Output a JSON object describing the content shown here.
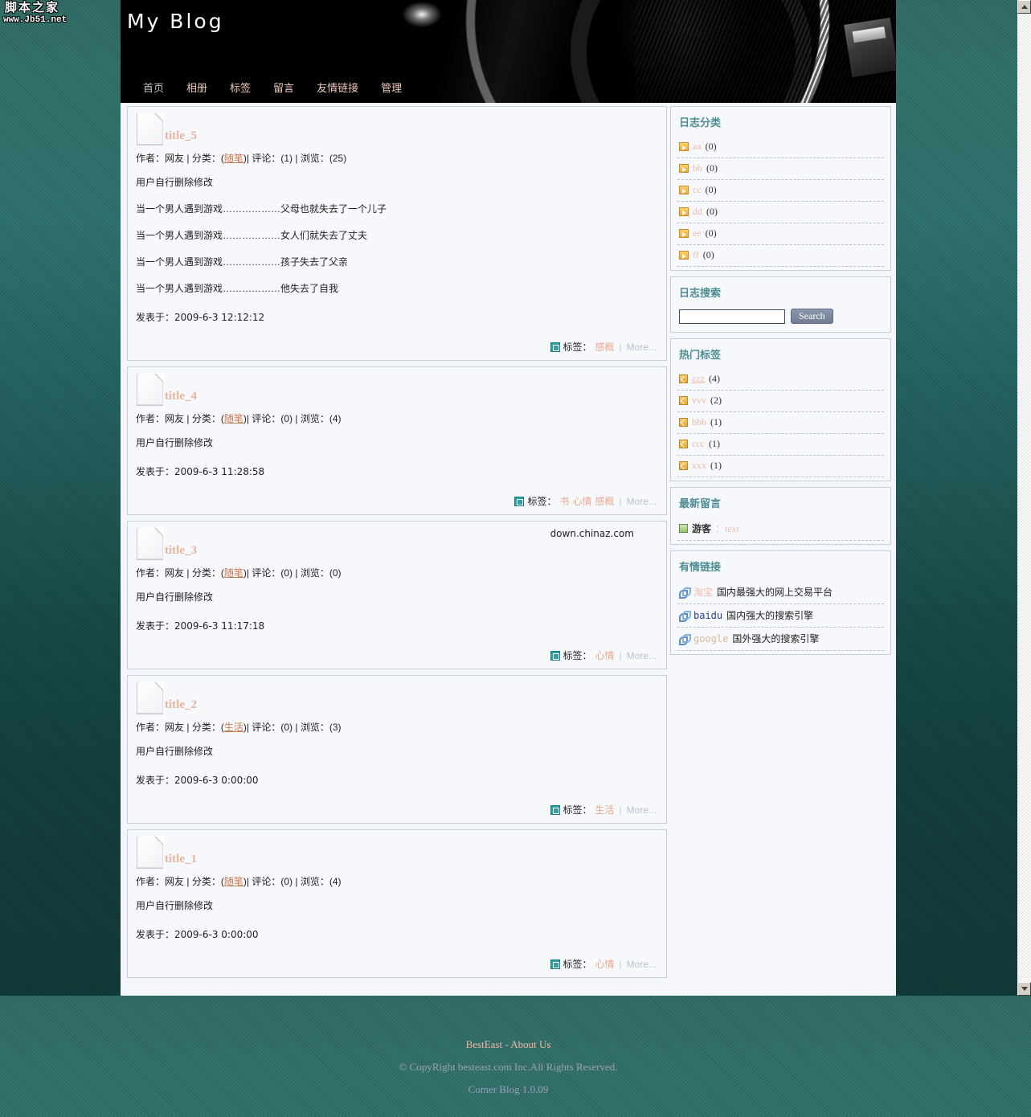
{
  "watermark": {
    "line1": "脚本之家",
    "line2": "www.Jb51.net"
  },
  "header": {
    "blog_title": "My Blog",
    "nav": [
      {
        "label": "首页",
        "name": "nav-home"
      },
      {
        "label": "相册",
        "name": "nav-album"
      },
      {
        "label": "标签",
        "name": "nav-tags"
      },
      {
        "label": "留言",
        "name": "nav-guestbook"
      },
      {
        "label": "友情链接",
        "name": "nav-links"
      },
      {
        "label": "管理",
        "name": "nav-admin"
      }
    ]
  },
  "labels": {
    "author": "作者：",
    "author_value": "网友",
    "category": "分类：",
    "comments": "评论：",
    "views": "浏览：",
    "posted_on": "发表于：",
    "tags": "标签：",
    "more": "More...",
    "sep": "|",
    "chinaz": "down.chinaz.com"
  },
  "posts": [
    {
      "title": "title_5",
      "author": "网友",
      "category": "随笔",
      "comments": "(1)",
      "views": "(25)",
      "lines": [
        "用户自行删除修改",
        "当一个男人遇到游戏………………父母也就失去了一个儿子",
        "当一个男人遇到游戏………………女人们就失去了丈夫",
        "当一个男人遇到游戏………………孩子失去了父亲",
        "当一个男人遇到游戏………………他失去了自我"
      ],
      "posted": "2009-6-3 12:12:12",
      "tags": [
        "感概"
      ]
    },
    {
      "title": "title_4",
      "author": "网友",
      "category": "随笔",
      "comments": "(0)",
      "views": "(4)",
      "lines": [
        "用户自行删除修改"
      ],
      "posted": "2009-6-3 11:28:58",
      "tags": [
        "书",
        "心情",
        "感概"
      ]
    },
    {
      "title": "title_3",
      "author": "网友",
      "category": "随笔",
      "comments": "(0)",
      "views": "(0)",
      "lines": [
        "用户自行删除修改"
      ],
      "posted": "2009-6-3 11:17:18",
      "tags": [
        "心情"
      ],
      "chinaz": "down.chinaz.com"
    },
    {
      "title": "title_2",
      "author": "网友",
      "category": "生活",
      "comments": "(0)",
      "views": "(3)",
      "lines": [
        "用户自行删除修改"
      ],
      "posted": "2009-6-3 0:00:00",
      "tags": [
        "生活"
      ]
    },
    {
      "title": "title_1",
      "author": "网友",
      "category": "随笔",
      "comments": "(0)",
      "views": "(4)",
      "lines": [
        "用户自行删除修改"
      ],
      "posted": "2009-6-3 0:00:00",
      "tags": [
        "心情"
      ]
    }
  ],
  "sidebar": {
    "categories": {
      "title": "日志分类",
      "items": [
        {
          "name": "aa",
          "count": "(0)"
        },
        {
          "name": "bb",
          "count": "(0)"
        },
        {
          "name": "cc",
          "count": "(0)"
        },
        {
          "name": "dd",
          "count": "(0)"
        },
        {
          "name": "ee",
          "count": "(0)"
        },
        {
          "name": "ff",
          "count": "(0)"
        }
      ]
    },
    "search": {
      "title": "日志搜索",
      "value": "",
      "placeholder": "",
      "button": "Search"
    },
    "hot_tags": {
      "title": "热门标签",
      "items": [
        {
          "name": "zzz",
          "count": "(4)"
        },
        {
          "name": "vvv",
          "count": "(2)"
        },
        {
          "name": "bbb",
          "count": "(1)"
        },
        {
          "name": "ccc",
          "count": "(1)"
        },
        {
          "name": "xxx",
          "count": "(1)"
        }
      ]
    },
    "latest_comments": {
      "title": "最新留言",
      "items": [
        {
          "user": "游客",
          "text": "：text"
        }
      ]
    },
    "friend_links": {
      "title": "有情链接",
      "items": [
        {
          "name": "淘宝",
          "desc": "国内最强大的网上交易平台",
          "color": "#edbaa4"
        },
        {
          "name": "baidu",
          "desc": "国内强大的搜索引擎",
          "color": "#2a3f8f"
        },
        {
          "name": "google",
          "desc": "国外强大的搜索引擎",
          "color": "#d9b79c"
        }
      ]
    }
  },
  "footer": {
    "about": "BestEast - About Us",
    "copyright": "© CopyRight besteast.com Inc.All Rights Reserved.",
    "version": "Comer Blog 1.0.09"
  },
  "colors": {
    "accent_pink": "#edbaa4",
    "panel_title": "#4c8d93",
    "bg_teal": "#2b6f6c",
    "panel_bg": "#f7f8fc"
  }
}
